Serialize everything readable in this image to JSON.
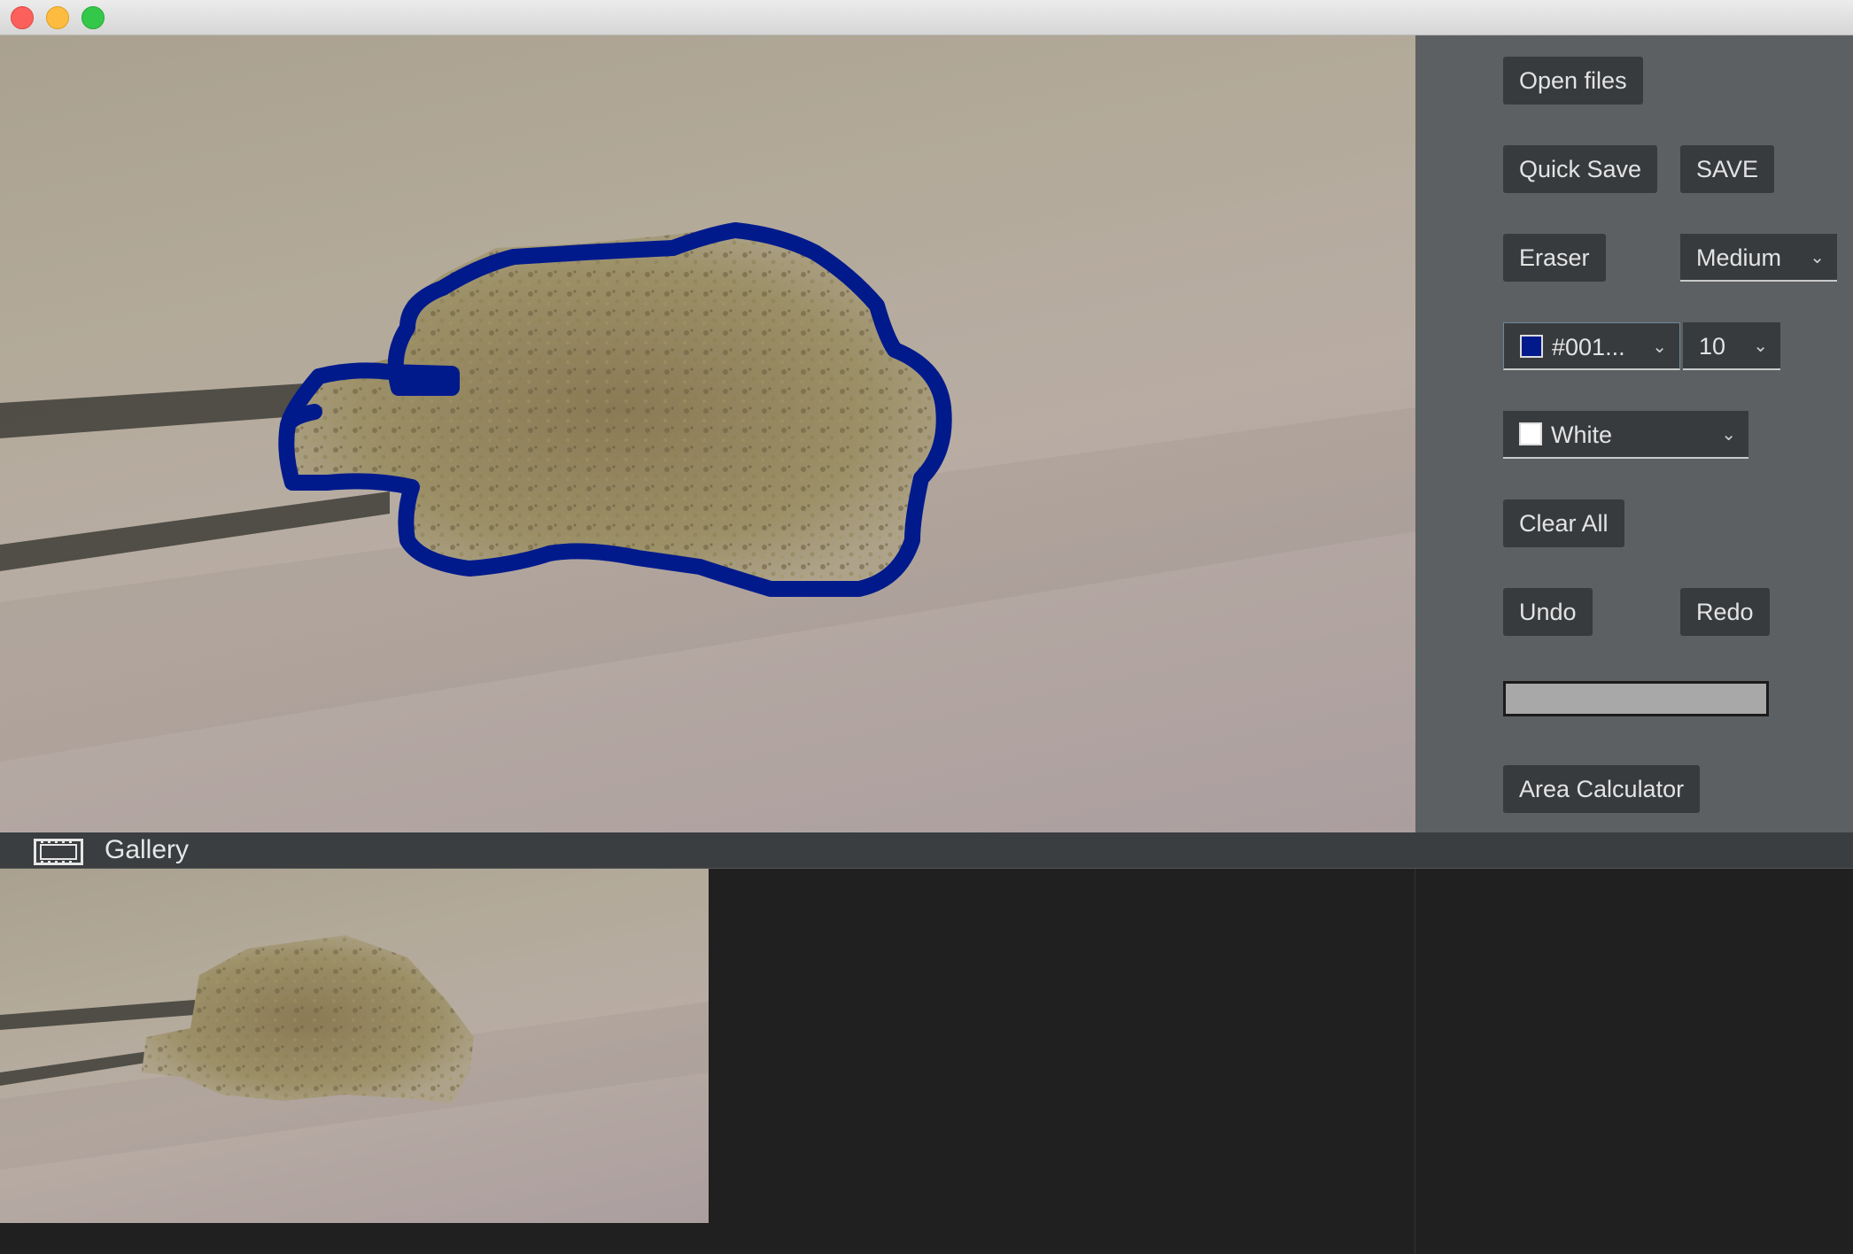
{
  "window": {
    "controls": [
      "close",
      "minimize",
      "zoom"
    ]
  },
  "toolbar": {
    "open_files": "Open files",
    "quick_save": "Quick Save",
    "save": "SAVE",
    "eraser": "Eraser",
    "brush_size_select": "Medium",
    "pen_color_select": "#001...",
    "pen_color_swatch": "#001a8c",
    "line_width_select": "10",
    "background_color_select": "White",
    "background_swatch": "#ffffff",
    "clear_all": "Clear All",
    "undo": "Undo",
    "redo": "Redo",
    "area_calculator": "Area Calculator"
  },
  "gallery": {
    "label": "Gallery",
    "icon": "film-strip-icon"
  },
  "colors": {
    "outline": "#001a8c",
    "panel": "#5c6063",
    "button": "#383b3e"
  }
}
